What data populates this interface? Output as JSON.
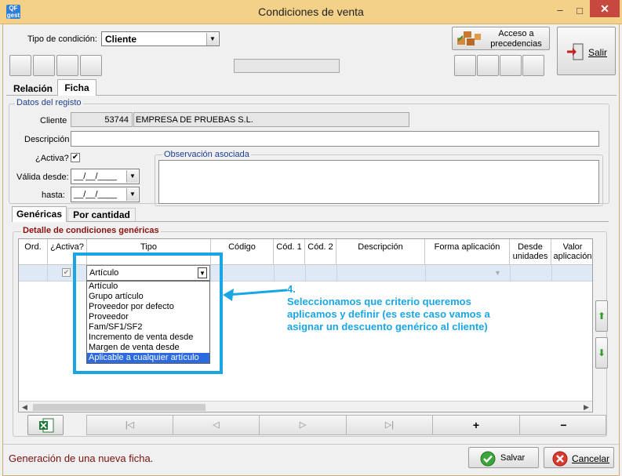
{
  "window": {
    "title": "Condiciones de venta",
    "app_icon_text": "QF gest",
    "minimize_glyph": "–",
    "maximize_glyph": "□",
    "close_glyph": "✕"
  },
  "header": {
    "condition_type_label": "Tipo de condición:",
    "condition_type_value": "Cliente",
    "access_button_label": "Acceso a precedencias",
    "exit_button_label": "Salir"
  },
  "tabs": [
    {
      "label": "Relación",
      "active": false
    },
    {
      "label": "Ficha",
      "active": true
    }
  ],
  "record": {
    "group_title": "Datos del registo",
    "client_label": "Cliente",
    "client_code": "53744",
    "client_name": "EMPRESA DE PRUEBAS S.L.",
    "description_label": "Descripción",
    "description_value": "",
    "active_label": "¿Activa?",
    "active_checked": true,
    "valid_from_label": "Válida desde:",
    "valid_from_value": "__/__/____",
    "until_label": "hasta:",
    "until_value": "__/__/____",
    "observation_title": "Observación asociada",
    "observation_value": ""
  },
  "subtabs": [
    {
      "label": "Genéricas",
      "active": true
    },
    {
      "label": "Por cantidad",
      "active": false
    }
  ],
  "detail": {
    "group_title": "Detalle de condiciones genéricas",
    "columns": [
      "Ord.",
      "¿Activa?",
      "Tipo",
      "Código",
      "Cód. 1",
      "Cód. 2",
      "Descripción",
      "Forma aplicación",
      "Desde unidades",
      "Valor aplicación"
    ],
    "row": {
      "ord": "",
      "active": true,
      "tipo": "Artículo"
    },
    "dropdown_options": [
      "Artículo",
      "Grupo artículo",
      "Proveedor por defecto",
      "Proveedor",
      "Fam/SF1/SF2",
      "Incremento de venta desde",
      "Margen de venta desde",
      "Aplicable a cualquier artículo"
    ],
    "dropdown_selected_index": 7
  },
  "annotation": {
    "step": "4.",
    "text_lines": [
      "Seleccionamos que criterio queremos",
      "aplicamos y definir (es este caso vamos a",
      "asignar un descuento genérico al cliente)"
    ],
    "color": "#1aa6e4"
  },
  "grid_toolbar": {
    "first_glyph": "|◁",
    "prev_glyph": "◁",
    "next_glyph": "▷",
    "last_glyph": "▷|",
    "add_glyph": "+",
    "remove_glyph": "−"
  },
  "footer": {
    "status": "Generación de una nueva ficha.",
    "save_label": "Salvar",
    "cancel_label": "Cancelar"
  },
  "colors": {
    "titlebar": "#f3d189",
    "status_text": "#7a1010",
    "group_title": "#1d3f8f",
    "selection": "#2c6ae0"
  }
}
